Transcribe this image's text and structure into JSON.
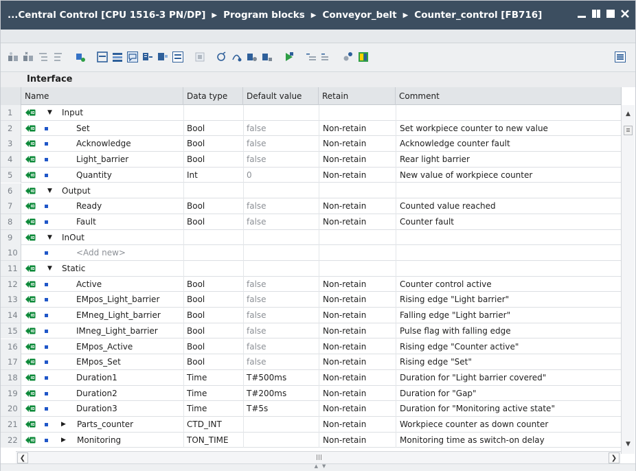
{
  "window": {
    "title_parts": [
      "...Central Control [CPU 1516-3 PN/DP]",
      "Program blocks",
      "Conveyor_belt",
      "Counter_control [FB716]"
    ],
    "separator": "▶"
  },
  "section_title": "Interface",
  "table": {
    "headers": [
      "Name",
      "Data type",
      "Default value",
      "Retain",
      "Comment"
    ],
    "rows": [
      {
        "num": "1",
        "kind": "group",
        "expand": "▼",
        "name": "Input",
        "type": "",
        "default": "",
        "retain": "",
        "comment": ""
      },
      {
        "num": "2",
        "kind": "var",
        "name": "Set",
        "type": "Bool",
        "default": "false",
        "retain": "Non-retain",
        "comment": "Set workpiece counter to new value"
      },
      {
        "num": "3",
        "kind": "var",
        "name": "Acknowledge",
        "type": "Bool",
        "default": "false",
        "retain": "Non-retain",
        "comment": "Acknowledge counter fault"
      },
      {
        "num": "4",
        "kind": "var",
        "name": "Light_barrier",
        "type": "Bool",
        "default": "false",
        "retain": "Non-retain",
        "comment": "Rear light barrier"
      },
      {
        "num": "5",
        "kind": "var",
        "name": "Quantity",
        "type": "Int",
        "default": "0",
        "retain": "Non-retain",
        "comment": "New value of workpiece counter"
      },
      {
        "num": "6",
        "kind": "group",
        "expand": "▼",
        "name": "Output",
        "type": "",
        "default": "",
        "retain": "",
        "comment": ""
      },
      {
        "num": "7",
        "kind": "var",
        "name": "Ready",
        "type": "Bool",
        "default": "false",
        "retain": "Non-retain",
        "comment": "Counted value reached"
      },
      {
        "num": "8",
        "kind": "var",
        "name": "Fault",
        "type": "Bool",
        "default": "false",
        "retain": "Non-retain",
        "comment": "Counter fault"
      },
      {
        "num": "9",
        "kind": "group",
        "expand": "▼",
        "name": "InOut",
        "type": "",
        "default": "",
        "retain": "",
        "comment": ""
      },
      {
        "num": "10",
        "kind": "add",
        "name": "<Add new>",
        "type": "",
        "default": "",
        "retain": "",
        "comment": ""
      },
      {
        "num": "11",
        "kind": "group",
        "expand": "▼",
        "name": "Static",
        "type": "",
        "default": "",
        "retain": "",
        "comment": ""
      },
      {
        "num": "12",
        "kind": "var",
        "name": "Active",
        "type": "Bool",
        "default": "false",
        "retain": "Non-retain",
        "comment": "Counter control active"
      },
      {
        "num": "13",
        "kind": "var",
        "name": "EMpos_Light_barrier",
        "type": "Bool",
        "default": "false",
        "retain": "Non-retain",
        "comment": "Rising edge \"Light barrier\""
      },
      {
        "num": "14",
        "kind": "var",
        "name": "EMneg_Light_barrier",
        "type": "Bool",
        "default": "false",
        "retain": "Non-retain",
        "comment": "Falling edge \"Light barrier\""
      },
      {
        "num": "15",
        "kind": "var",
        "name": "IMneg_Light_barrier",
        "type": "Bool",
        "default": "false",
        "retain": "Non-retain",
        "comment": "Pulse flag with falling edge"
      },
      {
        "num": "16",
        "kind": "var",
        "name": "EMpos_Active",
        "type": "Bool",
        "default": "false",
        "retain": "Non-retain",
        "comment": "Rising edge \"Counter active\""
      },
      {
        "num": "17",
        "kind": "var",
        "name": "EMpos_Set",
        "type": "Bool",
        "default": "false",
        "retain": "Non-retain",
        "comment": "Rising edge \"Set\""
      },
      {
        "num": "18",
        "kind": "var",
        "name": "Duration1",
        "type": "Time",
        "default": "T#500ms",
        "retain": "Non-retain",
        "comment": "Duration for \"Light barrier covered\""
      },
      {
        "num": "19",
        "kind": "var",
        "name": "Duration2",
        "type": "Time",
        "default": "T#200ms",
        "retain": "Non-retain",
        "comment": "Duration for \"Gap\""
      },
      {
        "num": "20",
        "kind": "var",
        "name": "Duration3",
        "type": "Time",
        "default": "T#5s",
        "retain": "Non-retain",
        "comment": "Duration for \"Monitoring active state\""
      },
      {
        "num": "21",
        "kind": "struct",
        "expand": "▶",
        "name": "Parts_counter",
        "type": "CTD_INT",
        "default": "",
        "retain": "Non-retain",
        "comment": "Workpiece counter as down counter"
      },
      {
        "num": "22",
        "kind": "struct",
        "expand": "▶",
        "name": "Monitoring",
        "type": "TON_TIME",
        "default": "",
        "retain": "Non-retain",
        "comment": "Monitoring time as switch-on delay"
      }
    ]
  },
  "toolbar_icons": [
    "insert-row-icon",
    "delete-row-icon",
    "indent-icon",
    "outdent-icon",
    "monitor-icon",
    "block-interface-icon",
    "collapse-icon",
    "comment-icon",
    "network-icon",
    "expand-all-icon",
    "collapse-all-icon",
    "snapshot-icon",
    "compare-icon",
    "download-icon",
    "watch-icon",
    "force-icon",
    "indent-left-icon",
    "indent-right-icon",
    "call-icon",
    "glasses-icon",
    "flag-icon"
  ],
  "colors": {
    "titlebar": "#3c4e60",
    "io_icon": "#0e8a3a",
    "dot": "#1f56c8",
    "dim_text": "#8c9096"
  }
}
